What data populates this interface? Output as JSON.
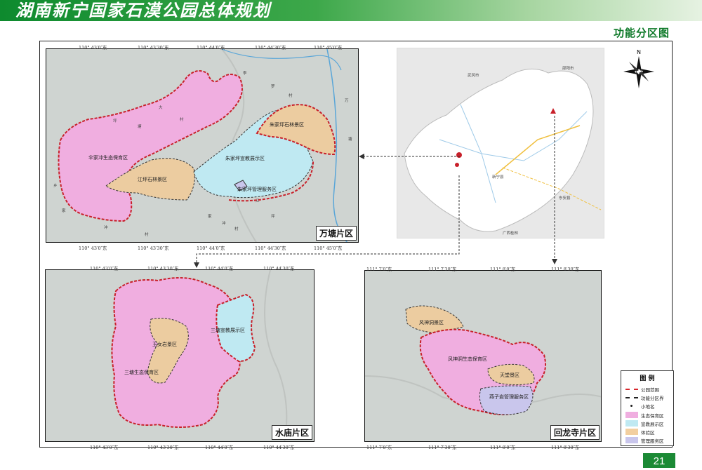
{
  "header": {
    "title": "湖南新宁国家石漠公园总体规划",
    "subtitle": "功能分区图"
  },
  "page_number": "21",
  "panels": {
    "wantang": {
      "label": "万塘片区",
      "zones": [
        "伞家冲生态保育区",
        "江坪石林景区",
        "朱家坪宣教展示区",
        "朱家坪石林景区",
        "朱家坪管理服务区"
      ],
      "place_names": [
        "李",
        "罗",
        "村",
        "万",
        "塘",
        "大",
        "坪",
        "塘",
        "村",
        "乡",
        "江",
        "坪",
        "家",
        "冲",
        "村",
        "家",
        "冲",
        "村"
      ],
      "coords_top": [
        "110° 43′0″东",
        "110° 43′30″东",
        "110° 44′0″东",
        "110° 44′30″东",
        "110° 45′0″东"
      ],
      "coords_bottom": [
        "110° 43′0″东",
        "110° 43′30″东",
        "110° 44′0″东",
        "110° 44′30″东",
        "110° 45′0″东"
      ],
      "coords_side": [
        "26° 41′0″北",
        "26° 40′30″北",
        "26° 40′0″北",
        "26° 39′30″北"
      ]
    },
    "shuimiao": {
      "label": "水庙片区",
      "zones": [
        "三塘生态保育区",
        "玉女岩景区",
        "三塘宣教展示区"
      ],
      "coords_top": [
        "110° 43′0″东",
        "110° 43′30″东",
        "110° 44′0″东",
        "110° 44′30″东"
      ],
      "coords_bottom": [
        "110° 43′0″东",
        "110° 43′30″东",
        "110° 44′0″东",
        "110° 44′30″东"
      ],
      "coords_side": [
        "26° 37′30″北",
        "26° 37′0″北",
        "26° 36′30″北"
      ]
    },
    "huilongsi": {
      "label": "回龙寺片区",
      "zones": [
        "风神洞景区",
        "风神洞生态保育区",
        "天堂景区",
        "燕子岩管理服务区"
      ],
      "coords_top": [
        "111° 7′0″东",
        "111° 7′30″东",
        "111° 8′0″东",
        "111° 8′30″东"
      ],
      "coords_bottom": [
        "111° 7′0″东",
        "111° 7′30″东",
        "111° 8′0″东",
        "111° 8′30″东"
      ],
      "coords_side": [
        "26° 42′30″北",
        "26° 42′0″北",
        "26° 41′30″北",
        "26° 41′0″北"
      ]
    },
    "overview": {
      "north": "N",
      "labels": [
        "广西桂林",
        "新宁县",
        "邵阳市",
        "武冈市",
        "东安县"
      ]
    }
  },
  "legend": {
    "title": "图 例",
    "items": [
      {
        "label": "公园范围",
        "kind": "line",
        "color": "#d9262c"
      },
      {
        "label": "功能分区界",
        "kind": "line",
        "color": "#222222"
      },
      {
        "label": "小地名",
        "kind": "dot",
        "color": "#222222"
      },
      {
        "label": "生态保育区",
        "kind": "fill",
        "color": "#f0aee0"
      },
      {
        "label": "宣教展示区",
        "kind": "fill",
        "color": "#bfe9f2"
      },
      {
        "label": "体验区",
        "kind": "fill",
        "color": "#f2cfa0"
      },
      {
        "label": "管理服务区",
        "kind": "fill",
        "color": "#c9c6ec"
      }
    ]
  },
  "colors": {
    "header": "#0e8a2e",
    "boundary": "#c8202a",
    "eco": "#f0aee0",
    "edu": "#bfe9f2",
    "scenic": "#eccca0",
    "service": "#c9c6ec",
    "satellite": "#cfd3d0"
  }
}
